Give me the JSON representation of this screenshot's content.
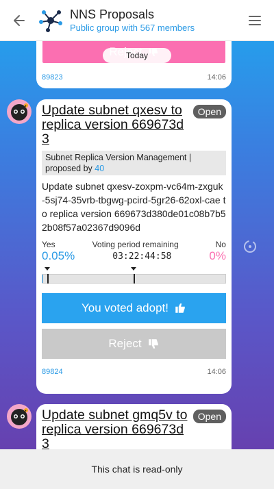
{
  "header": {
    "title": "NNS Proposals",
    "subtitle": "Public group with 567 members"
  },
  "date_pill": "Today",
  "prev_card": {
    "reject_label": "Reject",
    "message_id": "89823",
    "time": "14:06"
  },
  "proposal": {
    "title": "Update subnet qxesv to replica version 669673d3",
    "status": "Open",
    "topic": "Subnet Replica Version Management | proposed by",
    "proposer": "40",
    "summary": "Update subnet qxesv-zoxpm-vc64m-zxguk-5sj74-35vrb-tbgwg-pcird-5gr26-62oxl-cae to replica version 669673d380de01c08b7b52b08f57a02367d9096d",
    "yes_label": "Yes",
    "no_label": "No",
    "remaining_label": "Voting period remaining",
    "yes_pct": "0.05%",
    "no_pct": "0%",
    "yes_fraction": 0.0005,
    "deadline": "03:22:44:58",
    "adopt_label": "You voted adopt!",
    "reject_label": "Reject",
    "message_id": "89824",
    "time": "14:06"
  },
  "next_proposal": {
    "title": "Update subnet gmq5v to replica version 669673d3",
    "status": "Open"
  },
  "footer": {
    "text": "This chat is read-only"
  },
  "colors": {
    "accent": "#2a9ae5",
    "reject_pink": "#fb6fb1",
    "status_pill": "#5f5f5f"
  },
  "icons": [
    "back-arrow-icon",
    "network-avatar-icon",
    "hamburger-menu-icon",
    "thumbs-down-icon",
    "thumbs-up-icon",
    "bot-avatar-icon",
    "refresh-icon"
  ]
}
